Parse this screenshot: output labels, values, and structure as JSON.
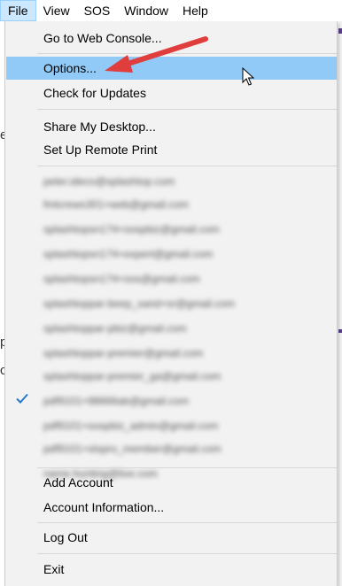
{
  "menubar": {
    "items": [
      "File",
      "View",
      "SOS",
      "Window",
      "Help"
    ]
  },
  "background": {
    "fragment_1": "e",
    "fragment_2": "p",
    "fragment_3": "c"
  },
  "file_menu": {
    "group1": [
      "Go to Web Console..."
    ],
    "group2": [
      "Options...",
      "Check for Updates"
    ],
    "group3": [
      "Share My Desktop...",
      "Set Up Remote Print"
    ],
    "accounts": [
      "peter.ideco@splashtop.com",
      "fmtcrews301+web@gmail.com",
      "splashtopsn174+sospbiz@gmail.com",
      "splashtopsn174+expert@gmail.com",
      "splashtopsn174+sos@gmail.com",
      "splashtoppar-beep_sand+sr@gmail.com",
      "splashtoppar-pbiz@gmail.com",
      "splashtoppar-premier@gmail.com",
      "splashtoppar-premier_ga@gmail.com",
      "pdf9101+98666ab@gmail.com",
      "pdf9101+sospbiz_admin@gmail.com",
      "pdf9101+stspro_member@gmail.com",
      "name.hunting@live.com"
    ],
    "checked_account_index": 9,
    "group5": [
      "Add Account",
      "Account Information..."
    ],
    "group6": [
      "Log Out"
    ],
    "group7": [
      "Exit"
    ]
  },
  "colors": {
    "highlight": "#91c9f7",
    "arrow": "#e03d3d",
    "check": "#2a77c9",
    "menu_background": "#f2f2f2"
  }
}
